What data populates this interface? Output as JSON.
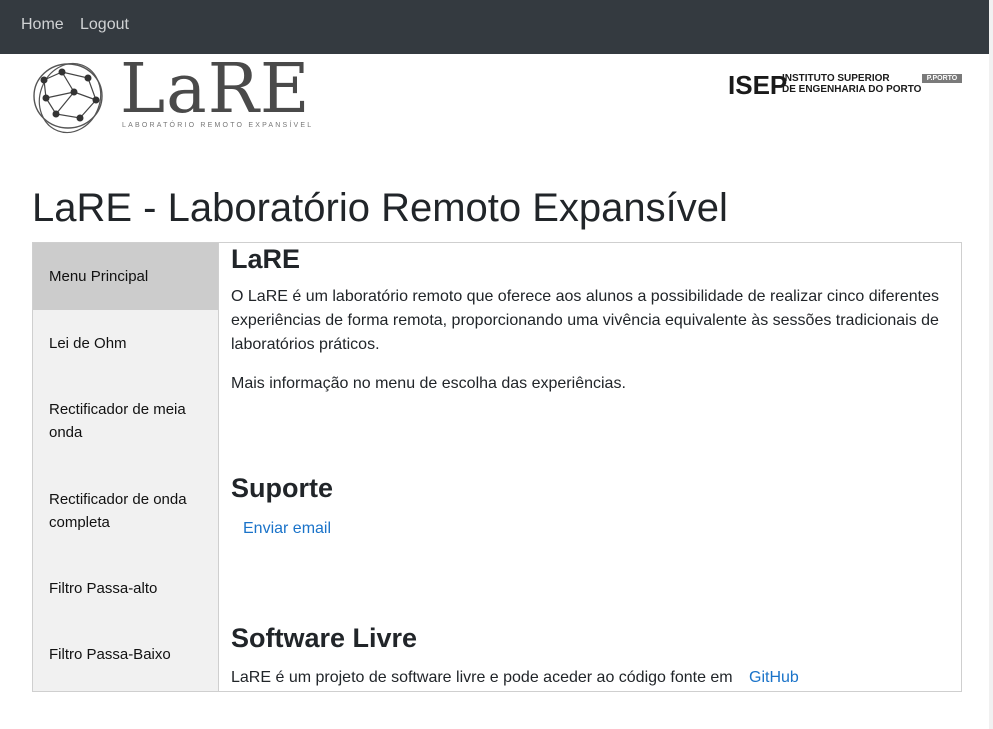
{
  "nav": {
    "home": "Home",
    "logout": "Logout"
  },
  "brand": {
    "name": "LaRE",
    "subtitle": "Laboratório Remoto Expansível"
  },
  "isep": {
    "acronym": "ISEP",
    "line1": "INSTITUTO SUPERIOR",
    "line2": "DE ENGENHARIA DO PORTO",
    "badge": "P.PORTO"
  },
  "page_title": "LaRE - Laboratório Remoto Expansível",
  "sidebar": {
    "items": [
      {
        "label": "Menu Principal"
      },
      {
        "label": "Lei de Ohm"
      },
      {
        "label": "Rectificador de meia onda"
      },
      {
        "label": "Rectificador de onda completa"
      },
      {
        "label": "Filtro Passa-alto"
      },
      {
        "label": "Filtro Passa-Baixo"
      }
    ]
  },
  "content": {
    "section1": {
      "title": "LaRE",
      "p1": "O LaRE é um laboratório remoto que oferece aos alunos a possibilidade de realizar cinco diferentes experiências de forma remota, proporcionando uma vivência equivalente às sessões tradicionais de laboratórios práticos.",
      "p2": "Mais informação no menu de escolha das experiências."
    },
    "section2": {
      "title": "Suporte",
      "link": "Enviar email"
    },
    "section3": {
      "title": "Software Livre",
      "text": "LaRE é um projeto de software livre e pode aceder ao código fonte em",
      "link": "GitHub"
    }
  },
  "colors": {
    "navbar": "#343a40",
    "link": "#1a73c9",
    "sidebar_active": "#cccccc",
    "sidebar_bg": "#f1f1f1"
  }
}
